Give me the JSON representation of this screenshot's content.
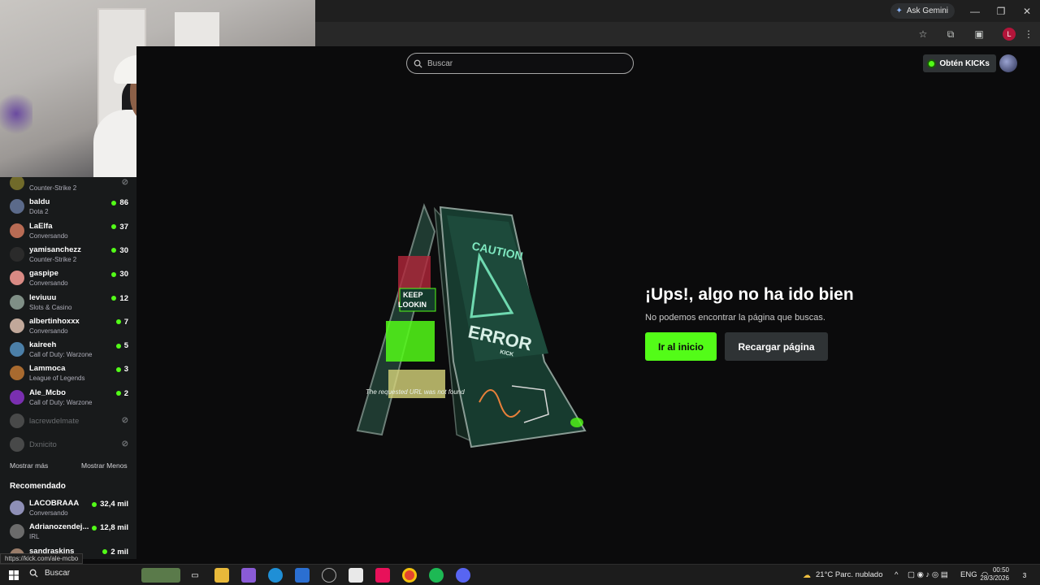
{
  "browser": {
    "gemini_label": "Ask Gemini",
    "minimize": "—",
    "restore": "❐",
    "close": "✕",
    "star": "☆",
    "extensions": "⧉",
    "media": "▣",
    "profile_initial": "L",
    "menu": "⋮"
  },
  "header": {
    "search_placeholder": "Buscar",
    "kicks_label": "Obtén KICKs"
  },
  "sidebar": {
    "channels": [
      {
        "name": "",
        "category": "Counter-Strike 2",
        "viewers": "",
        "avatar": "#c7b93a"
      },
      {
        "name": "baldu",
        "category": "Dota 2",
        "viewers": "86",
        "avatar": "#5b6a8a"
      },
      {
        "name": "LaElfa",
        "category": "Conversando",
        "viewers": "37",
        "avatar": "#b86b54"
      },
      {
        "name": "yamisanchezz",
        "category": "Counter-Strike 2",
        "viewers": "30",
        "avatar": "#2b2b2b"
      },
      {
        "name": "gaspipe",
        "category": "Conversando",
        "viewers": "30",
        "avatar": "#d98a84"
      },
      {
        "name": "leviuuu",
        "category": "Slots & Casino",
        "viewers": "12",
        "avatar": "#7f8f86"
      },
      {
        "name": "albertinhoxxx",
        "category": "Conversando",
        "viewers": "7",
        "avatar": "#c1a89a"
      },
      {
        "name": "kaireeh",
        "category": "Call of Duty: Warzone",
        "viewers": "5",
        "avatar": "#4b7fa8"
      },
      {
        "name": "Lammoca",
        "category": "League of Legends",
        "viewers": "3",
        "avatar": "#a86a2f"
      },
      {
        "name": "Ale_Mcbo",
        "category": "Call of Duty: Warzone",
        "viewers": "2",
        "avatar": "#7a2fb0"
      },
      {
        "name": "lacrewdelmate",
        "category": "",
        "viewers": "",
        "avatar": "#777"
      },
      {
        "name": "Dxnicito",
        "category": "",
        "viewers": "",
        "avatar": "#777"
      }
    ],
    "show_more": "Mostrar más",
    "show_less": "Mostrar Menos",
    "recommended_title": "Recomendado",
    "recommended": [
      {
        "name": "LACOBRAAA",
        "category": "Conversando",
        "viewers": "32,4 mil",
        "avatar": "#8e8fb6"
      },
      {
        "name": "Adrianozendej...",
        "category": "IRL",
        "viewers": "12,8 mil",
        "avatar": "#6b6b6b"
      },
      {
        "name": "sandraskins",
        "category": "",
        "viewers": "2 mil",
        "avatar": "#9a7d6a"
      }
    ],
    "status_url": "https://kick.com/ale-mcbo"
  },
  "error": {
    "title": "¡Ups!, algo no ha ido bien",
    "subtitle": "No podemos encontrar la página que buscas.",
    "home_button": "Ir al inicio",
    "reload_button": "Recargar página",
    "sign_header": "CAUTION",
    "sign_text": "ERROR",
    "sign_brand": "KICK",
    "sign_sticker_1": "KEEP",
    "sign_sticker_2": "LOOKIN",
    "sign_note": "The requested URL was not found"
  },
  "taskbar": {
    "search_label": "Buscar",
    "weather": "21°C  Parc. nublado",
    "lang": "ENG",
    "time": "00:50",
    "date": "28/3/2026",
    "notifications": "3"
  },
  "colors": {
    "kick_green": "#53fc18",
    "page_bg": "#0b0b0c",
    "sidebar_bg": "#181a1b",
    "button_gray": "#2f3335"
  }
}
